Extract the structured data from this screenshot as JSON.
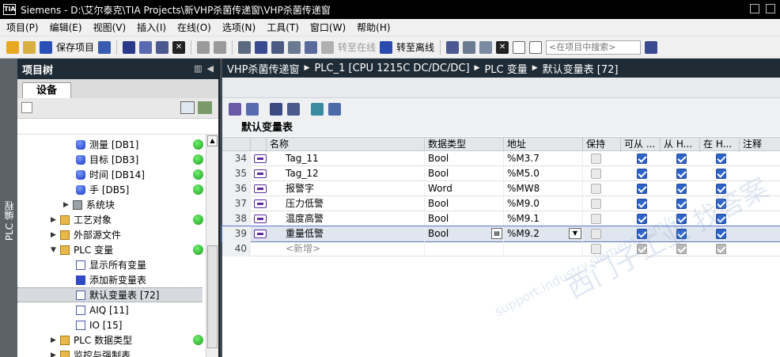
{
  "window": {
    "app_logo": "TIA",
    "title": "Siemens  -  D:\\艾尔泰克\\TIA  Projects\\新VHP杀菌传递窗\\VHP杀菌传递窗"
  },
  "menu": [
    {
      "label": "项目(P)"
    },
    {
      "label": "编辑(E)"
    },
    {
      "label": "视图(V)"
    },
    {
      "label": "插入(I)"
    },
    {
      "label": "在线(O)"
    },
    {
      "label": "选项(N)"
    },
    {
      "label": "工具(T)"
    },
    {
      "label": "窗口(W)"
    },
    {
      "label": "帮助(H)"
    }
  ],
  "toolbar": {
    "save_project": "保存项目",
    "go_online": "转至在线",
    "go_offline": "转至离线",
    "search_placeholder": "<在项目中搜索>"
  },
  "left_strip": {
    "label": "PLC 编程"
  },
  "project_tree": {
    "title": "项目树",
    "tab": "设备",
    "items": [
      {
        "label": "测量 [DB1]",
        "icon": "db-icon",
        "status": true
      },
      {
        "label": "目标 [DB3]",
        "icon": "db-icon",
        "status": true
      },
      {
        "label": "时间 [DB14]",
        "icon": "db-icon",
        "status": true
      },
      {
        "label": "手 [DB5]",
        "icon": "db-icon",
        "status": true
      },
      {
        "label": "系统块",
        "icon": "system-block-icon",
        "status": false
      },
      {
        "label": "工艺对象",
        "icon": "folder-icon",
        "status": true
      },
      {
        "label": "外部源文件",
        "icon": "folder-icon",
        "status": false
      },
      {
        "label": "PLC 变量",
        "icon": "folder-icon",
        "status": true
      },
      {
        "label": "显示所有变量",
        "icon": "tag-table-icon",
        "status": false
      },
      {
        "label": "添加新变量表",
        "icon": "add-tag-table-icon",
        "status": false
      },
      {
        "label": "默认变量表 [72]",
        "icon": "tag-table-icon",
        "status": false
      },
      {
        "label": "AIQ [11]",
        "icon": "tag-table-icon",
        "status": false
      },
      {
        "label": "IO [15]",
        "icon": "tag-table-icon",
        "status": false
      },
      {
        "label": "PLC 数据类型",
        "icon": "folder-icon",
        "status": true
      },
      {
        "label": "监控与强制表",
        "icon": "folder-icon",
        "status": false
      }
    ]
  },
  "breadcrumb": [
    "VHP杀菌传递窗",
    "PLC_1 [CPU 1215C DC/DC/DC]",
    "PLC 变量",
    "默认变量表 [72]"
  ],
  "tag_table": {
    "title": "默认变量表",
    "columns": [
      "名称",
      "数据类型",
      "地址",
      "保持",
      "可从 ...",
      "从 H...",
      "在 H...",
      "注释"
    ],
    "rows": [
      {
        "num": "34",
        "name": "Tag_11",
        "type": "Bool",
        "address": "%M3.7"
      },
      {
        "num": "35",
        "name": "Tag_12",
        "type": "Bool",
        "address": "%M5.0"
      },
      {
        "num": "36",
        "name": "报警字",
        "type": "Word",
        "address": "%MW8"
      },
      {
        "num": "37",
        "name": "压力低警",
        "type": "Bool",
        "address": "%M9.0"
      },
      {
        "num": "38",
        "name": "温度高警",
        "type": "Bool",
        "address": "%M9.1"
      },
      {
        "num": "39",
        "name": "重量低警",
        "type": "Bool",
        "address": "%M9.2"
      },
      {
        "num": "40",
        "name": "<新增>",
        "type": "",
        "address": ""
      }
    ]
  },
  "watermark": {
    "text": "西门子工业 找答案",
    "url": "support.industry.siemens.com/cs"
  }
}
